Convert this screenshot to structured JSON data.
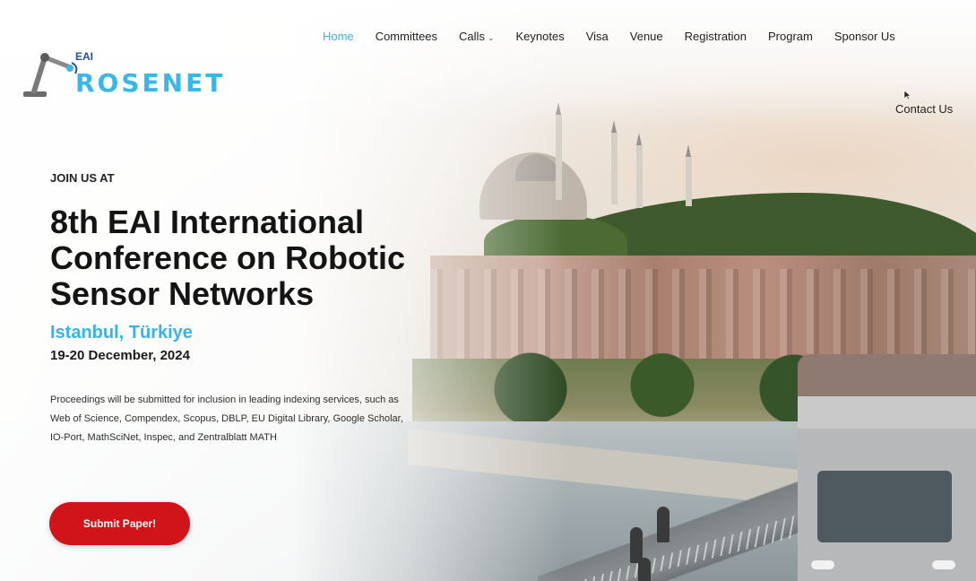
{
  "logo": {
    "eai": "EAI",
    "name": "ROSENET"
  },
  "nav": {
    "items": [
      {
        "label": "Home",
        "active": true
      },
      {
        "label": "Committees"
      },
      {
        "label": "Calls",
        "has_dropdown": true
      },
      {
        "label": "Keynotes"
      },
      {
        "label": "Visa"
      },
      {
        "label": "Venue"
      },
      {
        "label": "Registration"
      },
      {
        "label": "Program"
      },
      {
        "label": "Sponsor Us"
      }
    ],
    "contact": "Contact Us"
  },
  "hero": {
    "eyebrow": "JOIN US AT",
    "title": "8th EAI International Conference on Robotic Sensor Networks",
    "location": "Istanbul, Türkiye",
    "dates": "19-20 December, 2024",
    "proceedings": "Proceedings will be submitted for inclusion in leading indexing services, such as Web of Science, Compendex, Scopus, DBLP, EU Digital Library, Google Scholar, IO-Port, MathSciNet, Inspec, and Zentralblatt MATH",
    "cta": "Submit Paper!"
  },
  "colors": {
    "accent": "#3ab3e6",
    "cta": "#d0141a",
    "text": "#141414"
  }
}
